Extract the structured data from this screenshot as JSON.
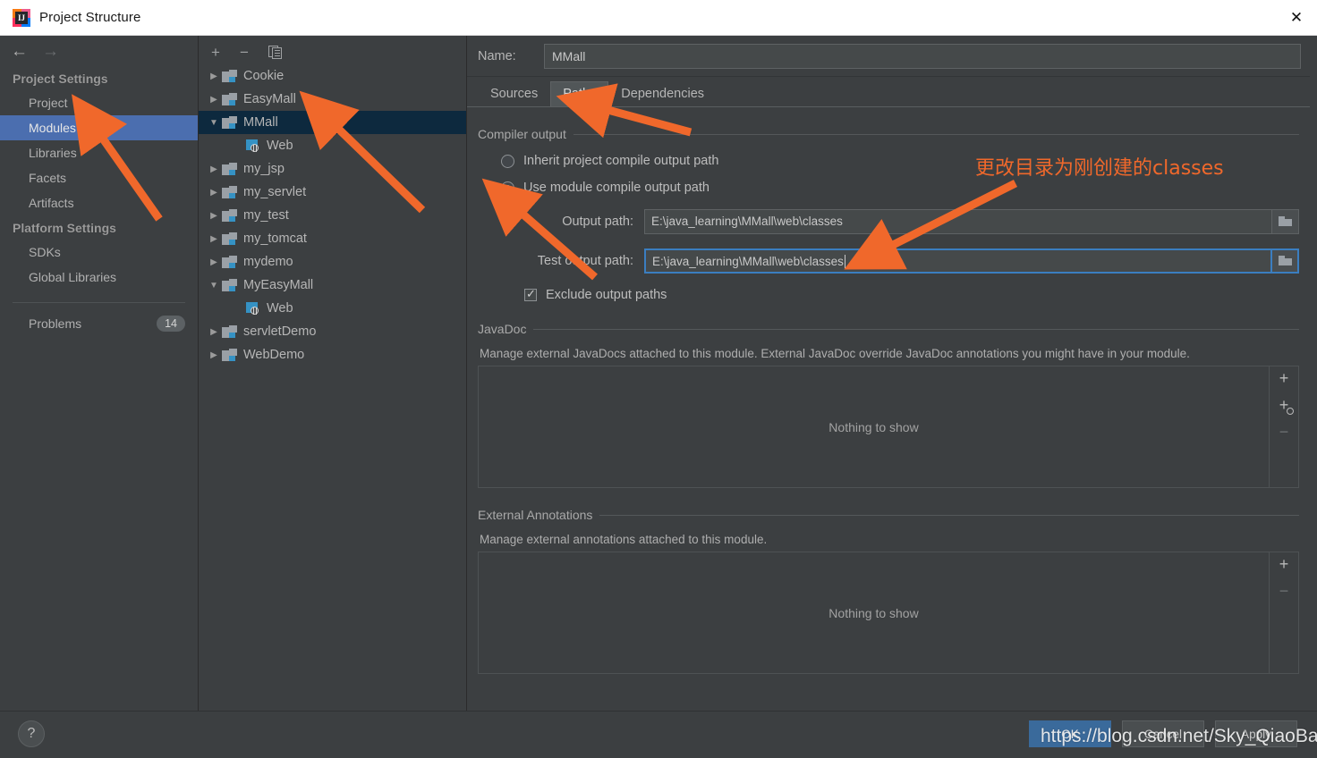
{
  "window": {
    "title": "Project Structure",
    "app_icon": "intellij-idea-icon",
    "close_label": "✕"
  },
  "sidebar": {
    "back_icon": "←",
    "forward_icon": "→",
    "groups": [
      {
        "label": "Project Settings",
        "items": [
          {
            "label": "Project",
            "selected": false
          },
          {
            "label": "Modules",
            "selected": true
          },
          {
            "label": "Libraries",
            "selected": false
          },
          {
            "label": "Facets",
            "selected": false
          },
          {
            "label": "Artifacts",
            "selected": false
          }
        ]
      },
      {
        "label": "Platform Settings",
        "items": [
          {
            "label": "SDKs",
            "selected": false
          },
          {
            "label": "Global Libraries",
            "selected": false
          }
        ]
      }
    ],
    "problems": {
      "label": "Problems",
      "count": "14"
    }
  },
  "tree": {
    "toolbar": {
      "add_label": "+",
      "remove_label": "−",
      "copy_label": "copy-icon"
    },
    "rows": [
      {
        "label": "Cookie",
        "icon": "module-icon",
        "twisty": "▶",
        "depth": 0,
        "selected": false
      },
      {
        "label": "EasyMall",
        "icon": "module-icon",
        "twisty": "▶",
        "depth": 0,
        "selected": false
      },
      {
        "label": "MMall",
        "icon": "module-icon",
        "twisty": "▼",
        "depth": 0,
        "selected": true
      },
      {
        "label": "Web",
        "icon": "web-facet-icon",
        "twisty": "",
        "depth": 1,
        "selected": false
      },
      {
        "label": "my_jsp",
        "icon": "module-icon",
        "twisty": "▶",
        "depth": 0,
        "selected": false
      },
      {
        "label": "my_servlet",
        "icon": "module-icon",
        "twisty": "▶",
        "depth": 0,
        "selected": false
      },
      {
        "label": "my_test",
        "icon": "module-icon",
        "twisty": "▶",
        "depth": 0,
        "selected": false
      },
      {
        "label": "my_tomcat",
        "icon": "module-icon",
        "twisty": "▶",
        "depth": 0,
        "selected": false
      },
      {
        "label": "mydemo",
        "icon": "module-icon",
        "twisty": "▶",
        "depth": 0,
        "selected": false
      },
      {
        "label": "MyEasyMall",
        "icon": "module-icon",
        "twisty": "▼",
        "depth": 0,
        "selected": false
      },
      {
        "label": "Web",
        "icon": "web-facet-icon",
        "twisty": "",
        "depth": 1,
        "selected": false
      },
      {
        "label": "servletDemo",
        "icon": "module-icon",
        "twisty": "▶",
        "depth": 0,
        "selected": false
      },
      {
        "label": "WebDemo",
        "icon": "module-icon",
        "twisty": "▶",
        "depth": 0,
        "selected": false
      }
    ]
  },
  "detail": {
    "name_label": "Name:",
    "name_value": "MMall",
    "tabs": [
      {
        "label": "Sources",
        "active": false
      },
      {
        "label": "Paths",
        "active": true
      },
      {
        "label": "Dependencies",
        "active": false
      }
    ],
    "compiler_output": {
      "title": "Compiler output",
      "option_inherit": "Inherit project compile output path",
      "option_module": "Use module compile output path",
      "selected_option": "Use module compile output path",
      "output_path_label": "Output path:",
      "output_path_value": "E:\\java_learning\\MMall\\web\\classes",
      "test_output_path_label": "Test output path:",
      "test_output_path_value": "E:\\java_learning\\MMall\\web\\classes",
      "exclude_label": "Exclude output paths",
      "exclude_checked": true,
      "browse_icon": "folder-icon"
    },
    "javadoc": {
      "title": "JavaDoc",
      "description": "Manage external JavaDocs attached to this module. External JavaDoc override JavaDoc annotations you might have in your module.",
      "empty_text": "Nothing to show",
      "buttons": [
        {
          "icon": "plus-icon",
          "label": "+",
          "enabled": true
        },
        {
          "icon": "add-url-icon",
          "label": "+",
          "enabled": true
        },
        {
          "icon": "minus-icon",
          "label": "−",
          "enabled": false
        }
      ]
    },
    "external_annotations": {
      "title": "External Annotations",
      "description": "Manage external annotations attached to this module.",
      "empty_text": "Nothing to show",
      "buttons": [
        {
          "icon": "plus-icon",
          "label": "+",
          "enabled": true
        },
        {
          "icon": "minus-icon",
          "label": "−",
          "enabled": false
        }
      ]
    }
  },
  "footer": {
    "help_label": "?",
    "ok_label": "OK",
    "cancel_label": "Cancel",
    "apply_label": "Apply"
  },
  "annotations": {
    "note_text": "更改目录为刚创建的classes",
    "accent_color": "#f0682b",
    "watermark": "https://blog.csdn.net/Sky_QiaoBa_Sum"
  }
}
